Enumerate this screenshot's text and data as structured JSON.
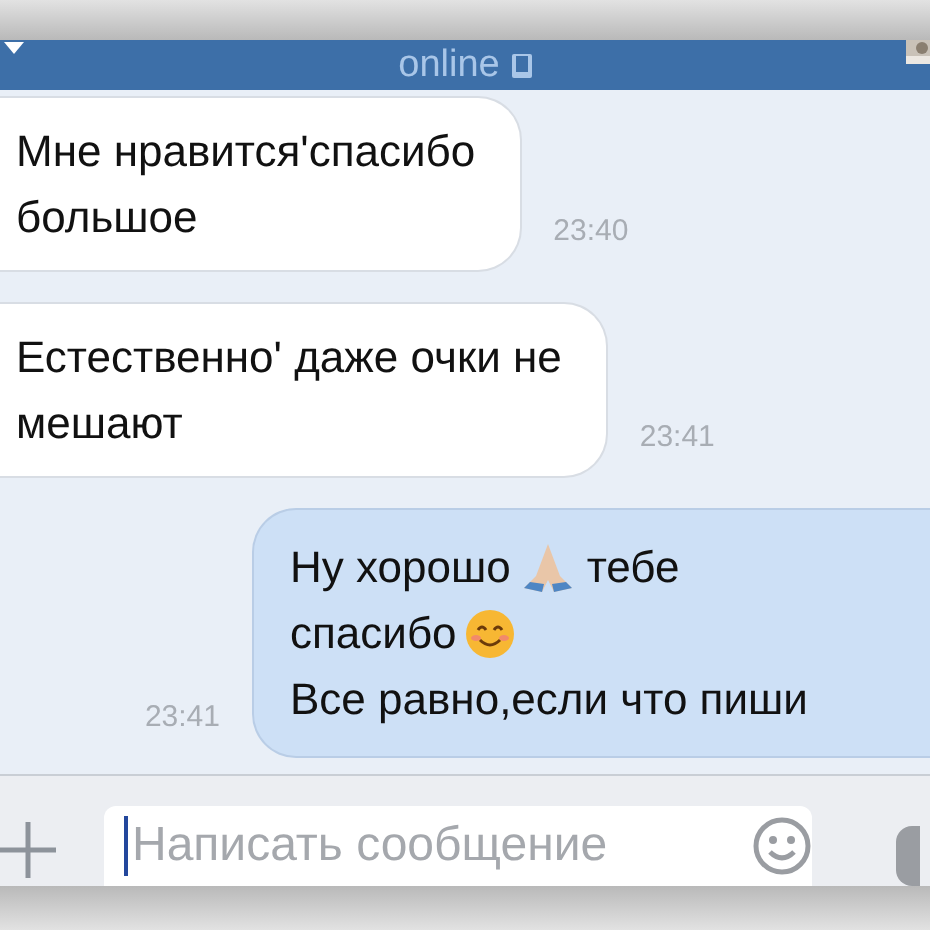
{
  "header": {
    "status": "online"
  },
  "messages": [
    {
      "kind": "incoming",
      "lines": [
        [
          {
            "kind": "text",
            "text": "Мне нравится'спасибо"
          }
        ],
        [
          {
            "kind": "text",
            "text": "большое"
          }
        ]
      ],
      "time": "23:40"
    },
    {
      "kind": "incoming",
      "lines": [
        [
          {
            "kind": "text",
            "text": "Естественно' даже очки не"
          }
        ],
        [
          {
            "kind": "text",
            "text": "мешают"
          }
        ]
      ],
      "time": "23:41"
    },
    {
      "kind": "outgoing",
      "lines": [
        [
          {
            "kind": "text",
            "text": "Ну хорошо"
          },
          {
            "kind": "pray"
          },
          {
            "kind": "text",
            "text": "тебе"
          }
        ],
        [
          {
            "kind": "text",
            "text": "спасибо"
          },
          {
            "kind": "smile"
          }
        ],
        [
          {
            "kind": "text",
            "text": "Все равно,если что пиши"
          }
        ]
      ],
      "time": "23:41"
    }
  ],
  "composer": {
    "placeholder": "Написать сообщение"
  }
}
